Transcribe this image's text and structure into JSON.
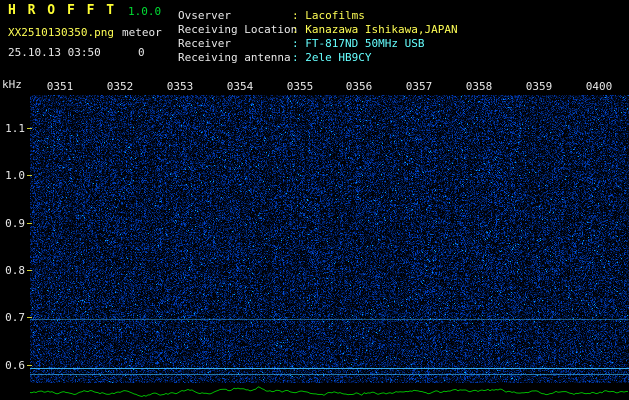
{
  "header": {
    "app_title": "H R O F F T",
    "version": "1.0.0",
    "filename": "XX2510130350.png",
    "mode": "meteor",
    "datetime": "25.10.13 03:50",
    "count": "0"
  },
  "info": {
    "rows": [
      {
        "label": "Ovserver",
        "value": ": Lacofilms"
      },
      {
        "label": "Receiving Location",
        "value": ": Kanazawa Ishikawa,JAPAN"
      },
      {
        "label": "Receiver",
        "value": ": FT-817ND 50MHz USB"
      },
      {
        "label": "Receiving antenna",
        "value": ": 2ele HB9CY"
      }
    ]
  },
  "axes": {
    "unit": "kHz",
    "freq_ticks": [
      "1.1",
      "1.0",
      "0.9",
      "0.8",
      "0.7",
      "0.6"
    ],
    "time_ticks": [
      "0351",
      "0352",
      "0353",
      "0354",
      "0355",
      "0356",
      "0357",
      "0358",
      "0359",
      "0400"
    ]
  },
  "spectrogram": {
    "noise_color": "#0020a0",
    "speckle_color": "#00ccff",
    "freq_top_khz": 1.17,
    "freq_bottom_khz": 0.565,
    "signal_lines": [
      {
        "khz": 0.7,
        "intensity": 0.45
      },
      {
        "khz": 0.596,
        "intensity": 0.9
      },
      {
        "khz": 0.583,
        "intensity": 0.6
      }
    ]
  },
  "level_trace": {
    "color": "#00bb00"
  },
  "colors": {
    "title_yellow": "#ffff33",
    "version_green": "#00dd33",
    "text_white": "#e8e8e8",
    "value_yellow": "#ffff55",
    "value_cyan": "#66ffff",
    "tick_yellow": "#cccc33",
    "background": "#000000"
  }
}
